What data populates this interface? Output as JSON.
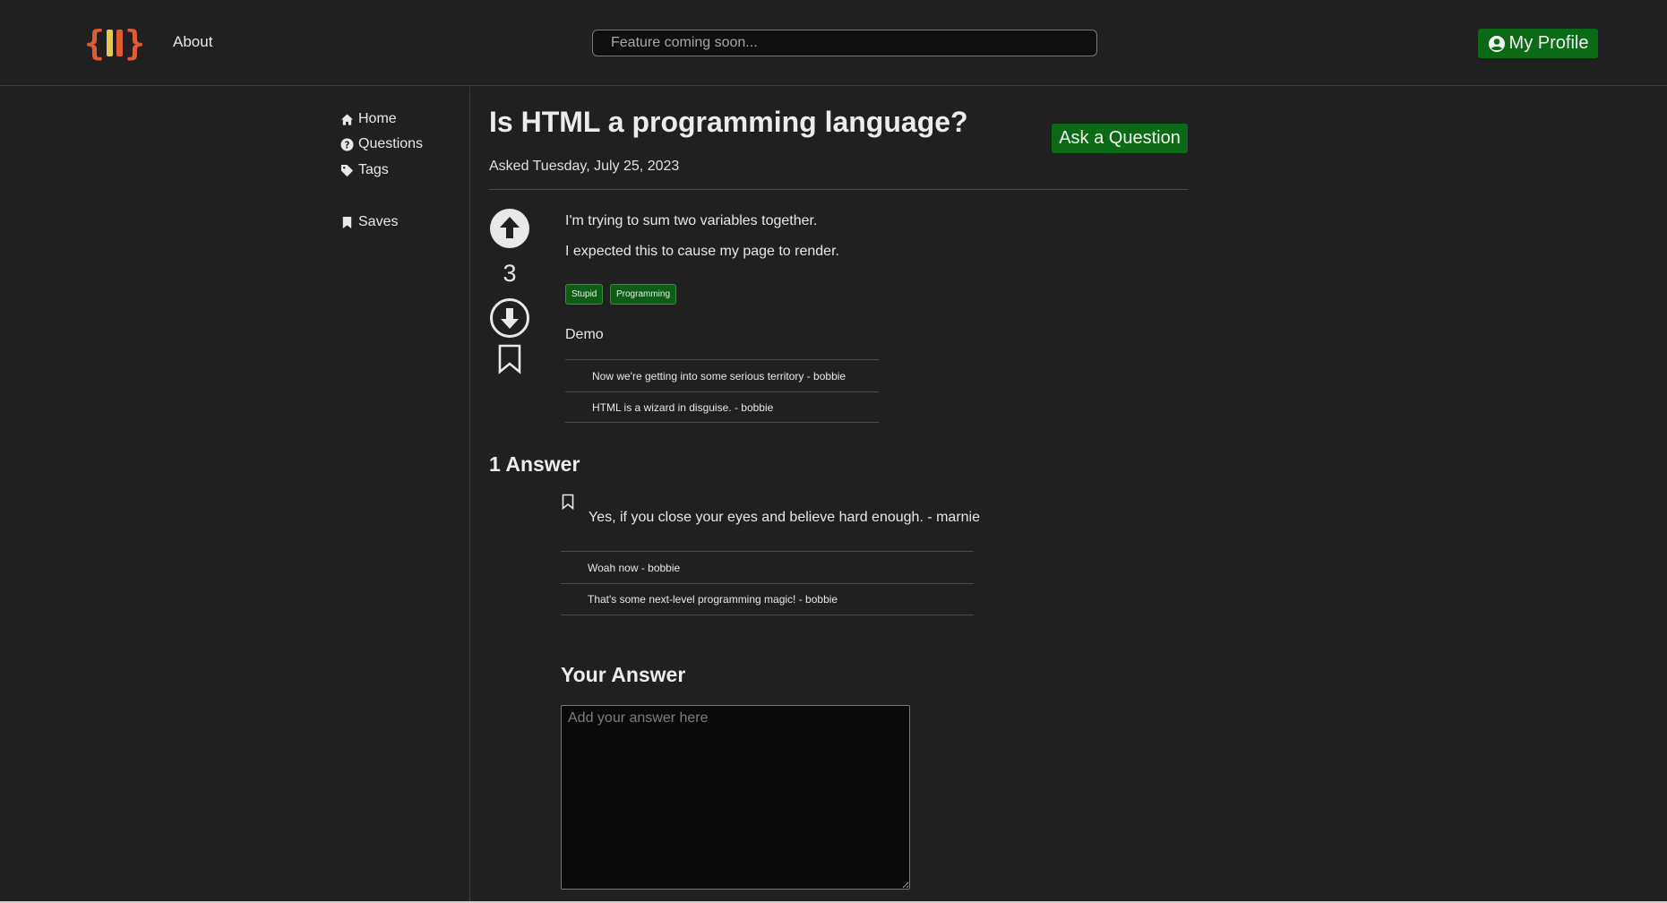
{
  "header": {
    "about_label": "About",
    "search_placeholder": "Feature coming soon...",
    "profile_label": "My Profile"
  },
  "sidebar": {
    "items": [
      {
        "label": "Home",
        "icon": "home-icon"
      },
      {
        "label": "Questions",
        "icon": "question-circle-icon"
      },
      {
        "label": "Tags",
        "icon": "tag-icon"
      },
      {
        "label": "Saves",
        "icon": "bookmark-icon"
      }
    ]
  },
  "question": {
    "title": "Is HTML a programming language?",
    "ask_button": "Ask a Question",
    "asked": "Asked Tuesday, July 25, 2023",
    "votes": "3",
    "body": [
      "I'm trying to sum two variables together.",
      "I expected this to cause my page to render."
    ],
    "tags": [
      "Stupid",
      "Programming"
    ],
    "demo_label": "Demo",
    "comments": [
      "Now we're getting into some serious territory - bobbie",
      "HTML is a wizard in disguise. - bobbie"
    ]
  },
  "answers": {
    "heading": "1 Answer",
    "items": [
      {
        "text": "Yes, if you close your eyes and believe hard enough. - marnie",
        "comments": [
          "Woah now - bobbie",
          "That's some next-level programming magic! - bobbie"
        ]
      }
    ]
  },
  "your_answer": {
    "heading": "Your Answer",
    "placeholder": "Add your answer here"
  },
  "colors": {
    "background": "#202020",
    "accent_green": "#0b6a15",
    "logo_orange": "#e05a33",
    "logo_yellow": "#e8c84a"
  }
}
